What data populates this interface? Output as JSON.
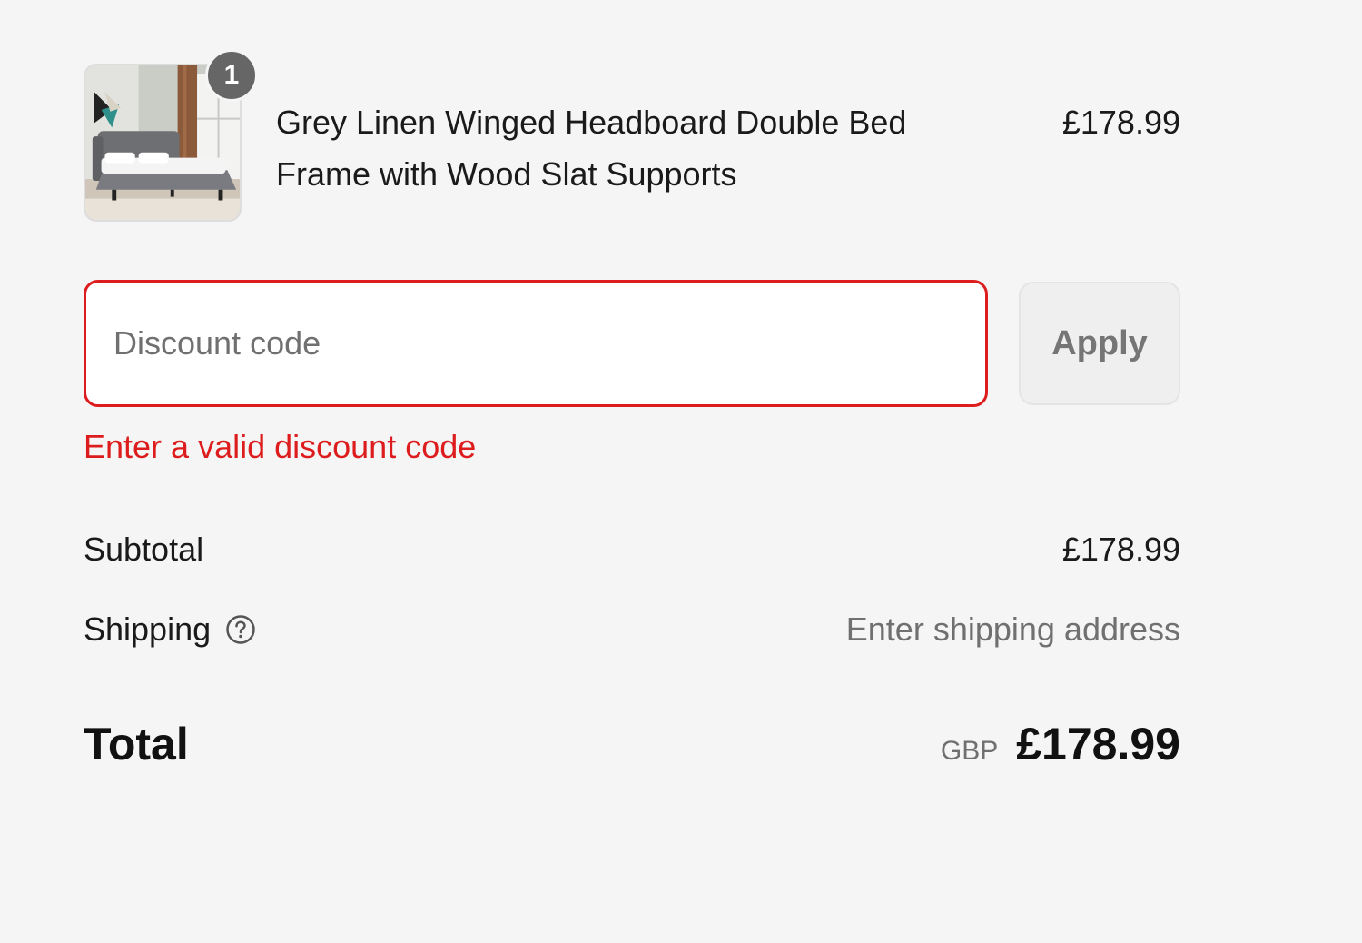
{
  "line_item": {
    "quantity": "1",
    "title": "Grey Linen Winged Headboard Double Bed Frame with Wood Slat Supports",
    "price": "£178.99",
    "image_icon": "bed-product-image"
  },
  "discount": {
    "placeholder": "Discount code",
    "value": "",
    "apply_label": "Apply",
    "error": "Enter a valid discount code",
    "error_color": "#dd1d1d"
  },
  "totals": {
    "subtotal_label": "Subtotal",
    "subtotal_value": "£178.99",
    "shipping_label": "Shipping",
    "shipping_help_icon": "question-circle-icon",
    "shipping_value": "Enter shipping address",
    "total_label": "Total",
    "currency": "GBP",
    "total_value": "£178.99"
  }
}
